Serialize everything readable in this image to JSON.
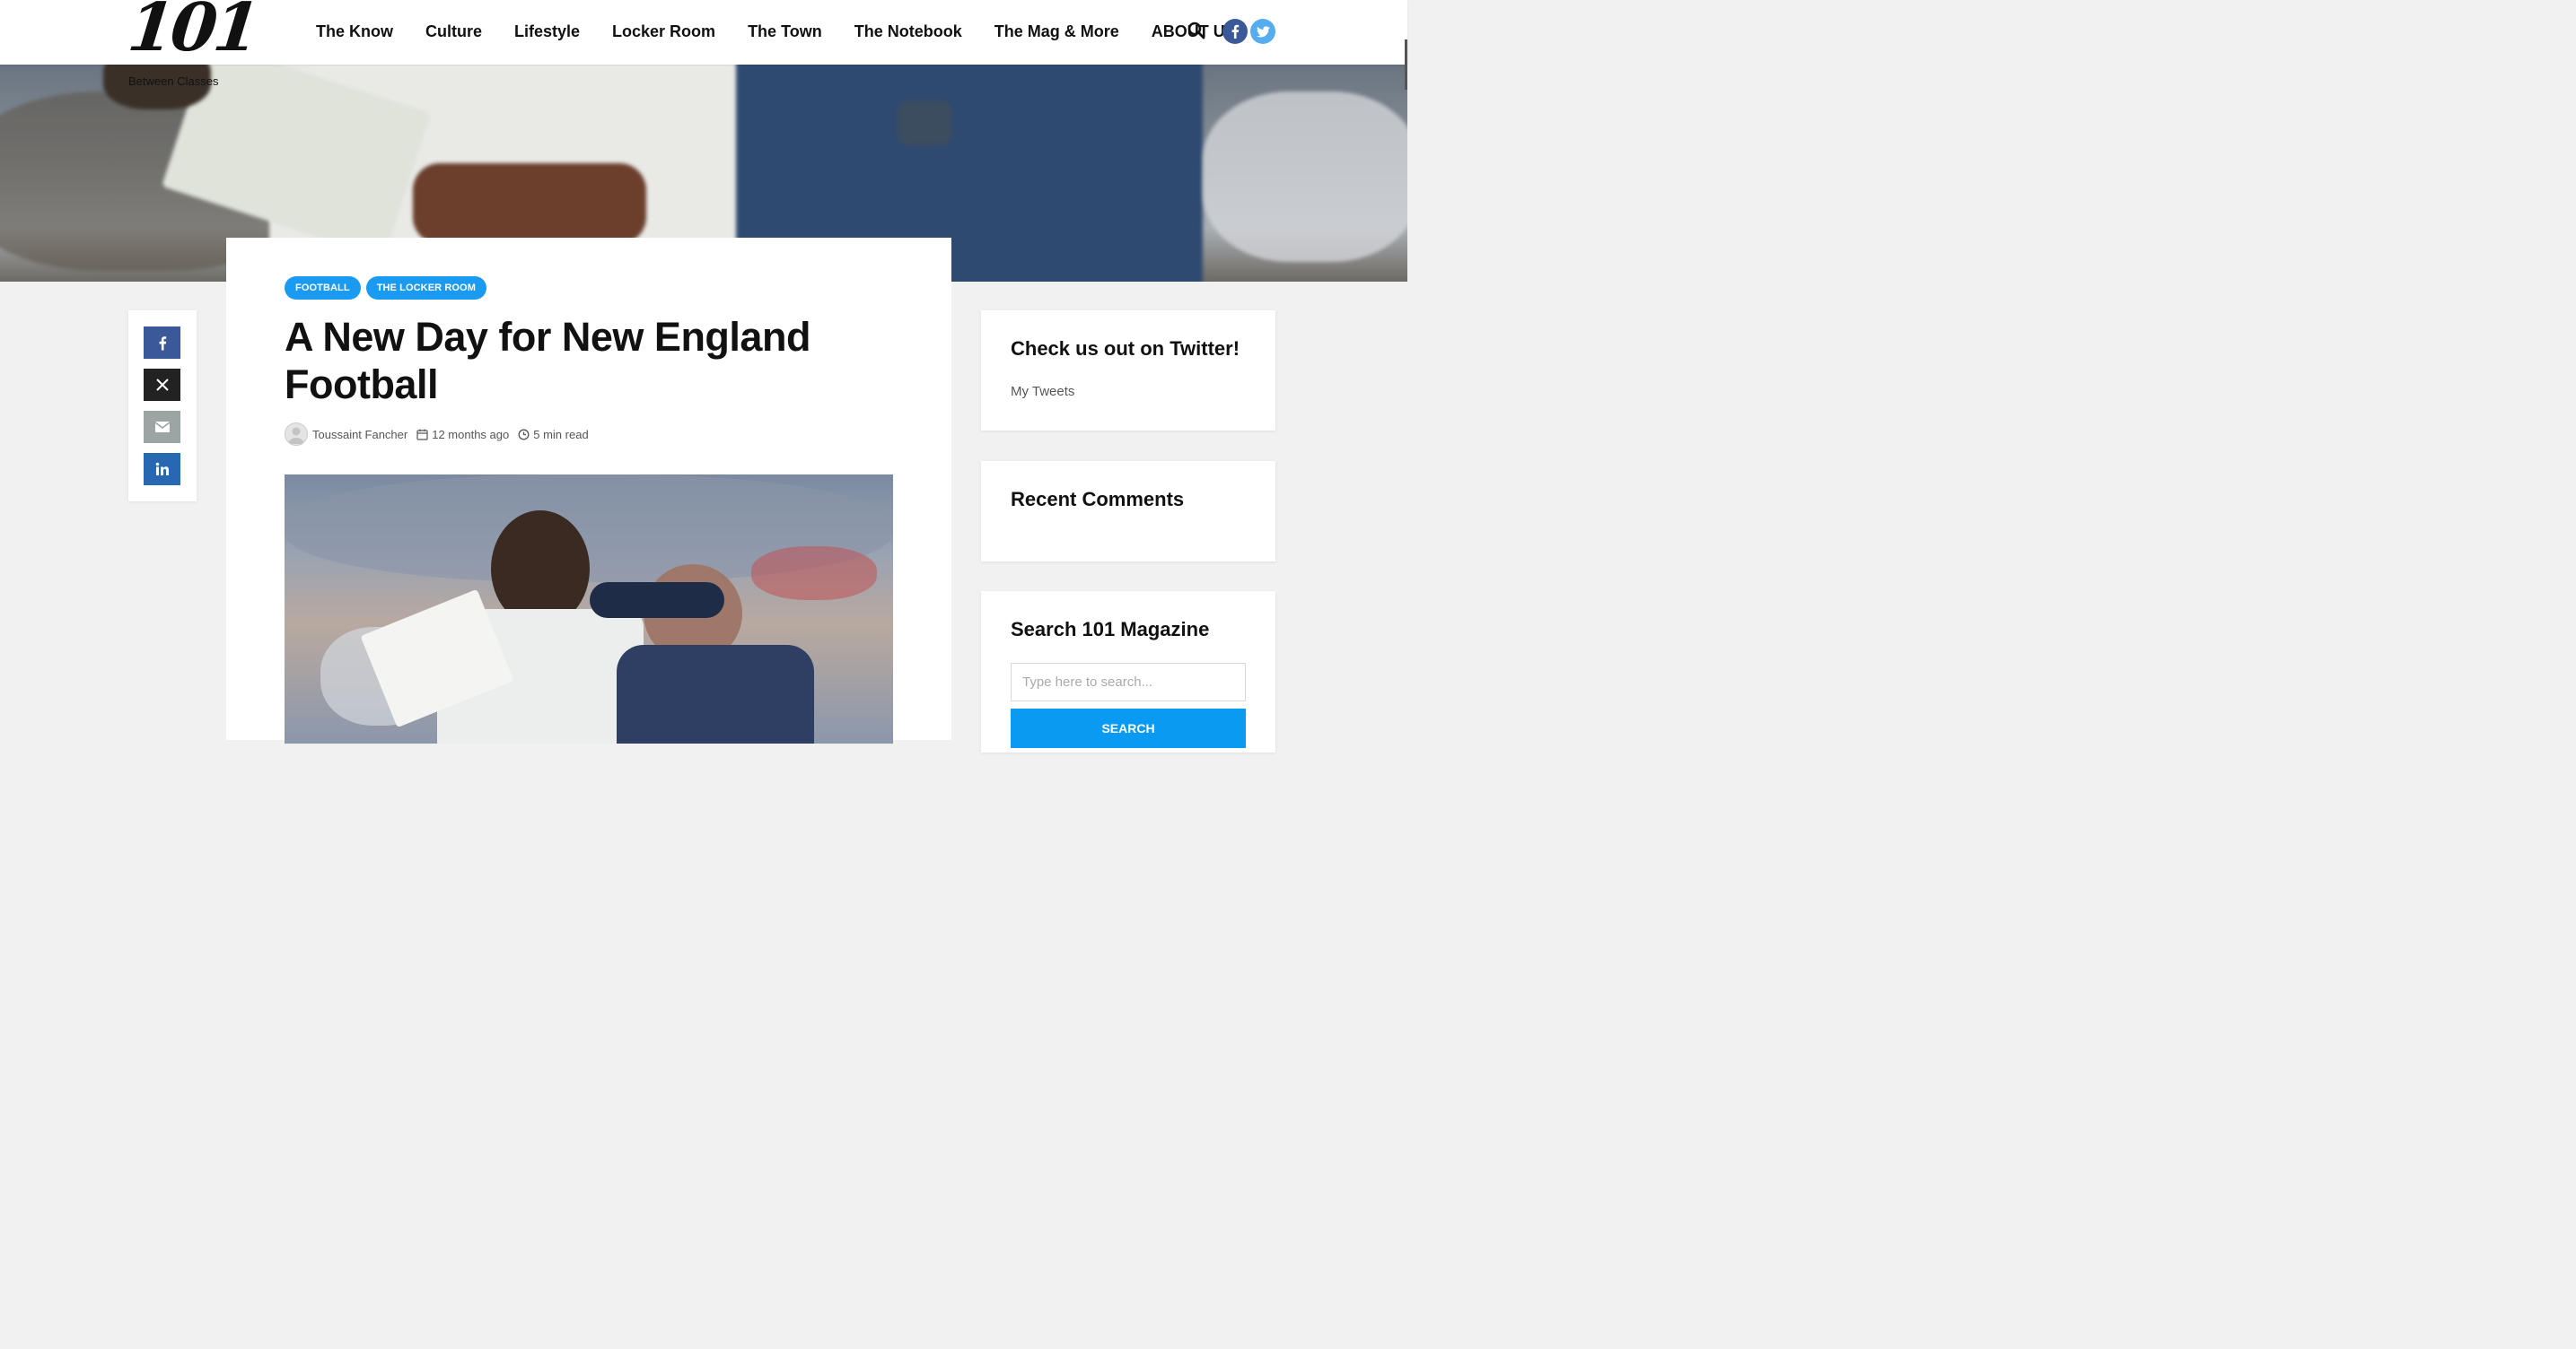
{
  "site": {
    "logo_text": "101",
    "tagline": "Between Classes"
  },
  "nav": {
    "items": [
      {
        "label": "The Know"
      },
      {
        "label": "Culture"
      },
      {
        "label": "Lifestyle"
      },
      {
        "label": "Locker Room"
      },
      {
        "label": "The Town"
      },
      {
        "label": "The Notebook"
      },
      {
        "label": "The Mag & More"
      },
      {
        "label": "ABOUT US"
      }
    ],
    "search_icon": "search-icon",
    "social": [
      {
        "name": "facebook-icon",
        "glyph": "f",
        "color": "#3b5998"
      },
      {
        "name": "twitter-icon",
        "glyph": "t",
        "color": "#55acee"
      }
    ]
  },
  "share": {
    "buttons": [
      {
        "name": "share-facebook",
        "color": "#3b5998"
      },
      {
        "name": "share-x",
        "color": "#222222"
      },
      {
        "name": "share-email",
        "color": "#9aa5a4"
      },
      {
        "name": "share-linkedin",
        "color": "#2867b2"
      }
    ]
  },
  "article": {
    "categories": [
      "FOOTBALL",
      "THE LOCKER ROOM"
    ],
    "title": "A New Day for New England Football",
    "author": "Toussaint Fancher",
    "date": "12 months ago",
    "read_time": "5 min read"
  },
  "sidebar": {
    "twitter": {
      "title": "Check us out on Twitter!",
      "link": "My Tweets"
    },
    "comments": {
      "title": "Recent Comments"
    },
    "search": {
      "title": "Search 101 Magazine",
      "placeholder": "Type here to search...",
      "button": "SEARCH"
    }
  },
  "colors": {
    "accent": "#1a9af0",
    "background": "#f1f1f1"
  }
}
